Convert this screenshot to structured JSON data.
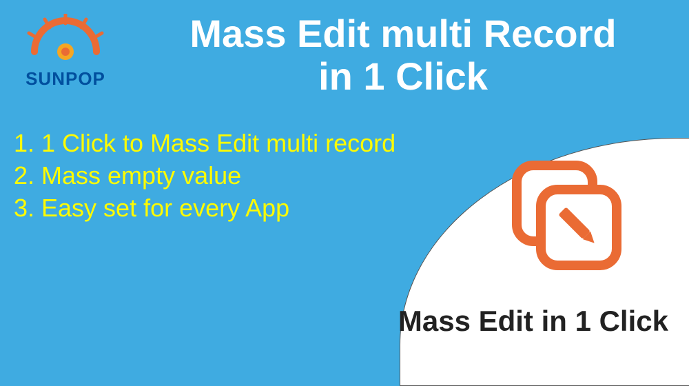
{
  "logo": {
    "brand": "SUNPOP"
  },
  "title_line1": "Mass Edit multi  Record",
  "title_line2": "in 1 Click",
  "features": {
    "item1": "1. 1 Click to Mass Edit multi record",
    "item2": "2. Mass empty value",
    "item3": "3. Easy set for every App"
  },
  "bottom_title": "Mass Edit in 1 Click",
  "colors": {
    "background": "#3fabe1",
    "accent": "#ea6b34",
    "feature_text": "#fffb00",
    "logo_blue": "#004f9e"
  }
}
